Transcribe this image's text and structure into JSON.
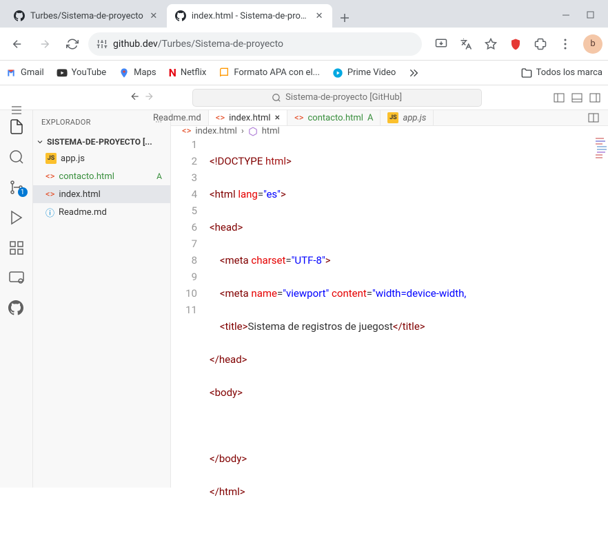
{
  "browser": {
    "tabs": [
      {
        "title": "Turbes/Sistema-de-proyecto",
        "active": false
      },
      {
        "title": "index.html - Sistema-de-proyec",
        "active": true
      }
    ],
    "url_prefix": "github.dev",
    "url_path": "/Turbes/Sistema-de-proyecto",
    "avatar_letter": "b"
  },
  "bookmarks": [
    {
      "label": "Gmail",
      "icon": "gmail"
    },
    {
      "label": "YouTube",
      "icon": "youtube"
    },
    {
      "label": "Maps",
      "icon": "maps"
    },
    {
      "label": "Netflix",
      "icon": "netflix"
    },
    {
      "label": "Formato APA con el...",
      "icon": "apa"
    },
    {
      "label": "Prime Video",
      "icon": "prime"
    }
  ],
  "bookmarks_folder": "Todos los marca",
  "command_center": "Sistema-de-proyecto [GitHub]",
  "sidebar": {
    "header": "EXPLORADOR",
    "project": "SISTEMA-DE-PROYECTO [...",
    "items": [
      {
        "name": "app.js",
        "type": "js",
        "status": "",
        "selected": false
      },
      {
        "name": "contacto.html",
        "type": "html",
        "status": "A",
        "selected": false
      },
      {
        "name": "index.html",
        "type": "html",
        "status": "",
        "selected": true
      },
      {
        "name": "Readme.md",
        "type": "md",
        "status": "",
        "selected": false
      }
    ]
  },
  "source_control_badge": "1",
  "editor_tabs": [
    {
      "label": "Readme.md",
      "type": "md",
      "active": false,
      "close": false,
      "status": ""
    },
    {
      "label": "index.html",
      "type": "html",
      "active": true,
      "close": true,
      "status": ""
    },
    {
      "label": "contacto.html",
      "type": "html",
      "active": false,
      "close": false,
      "status": "A"
    },
    {
      "label": "app.js",
      "type": "js",
      "active": false,
      "close": false,
      "status": "",
      "italic": true
    }
  ],
  "breadcrumbs": [
    {
      "label": "index.html",
      "icon": "html"
    },
    {
      "label": "html",
      "icon": "cube"
    }
  ],
  "code": {
    "lines": [
      "1",
      "2",
      "3",
      "4",
      "5",
      "6",
      "7",
      "8",
      "9",
      "10",
      "11"
    ],
    "l1_doctype": "<!DOCTYPE",
    "l1_html": " html",
    "l1_end": ">",
    "l2_open": "<html",
    "l2_attr": " lang",
    "l2_eq": "=",
    "l2_val": "\"es\"",
    "l2_close": ">",
    "l3": "<head>",
    "l4_open": "<meta",
    "l4_attr": " charset",
    "l4_eq": "=",
    "l4_val": "\"UTF-8\"",
    "l4_close": ">",
    "l5_open": "<meta",
    "l5_attr1": " name",
    "l5_eq1": "=",
    "l5_val1": "\"viewport\"",
    "l5_attr2": " content",
    "l5_eq2": "=",
    "l5_val2": "\"width=device-width,",
    "l6_open": "<title>",
    "l6_txt": "Sistema de registros de juegost",
    "l6_close": "</title>",
    "l7": "</head>",
    "l8": "<body>",
    "l10": "</body>",
    "l11": "</html>"
  }
}
